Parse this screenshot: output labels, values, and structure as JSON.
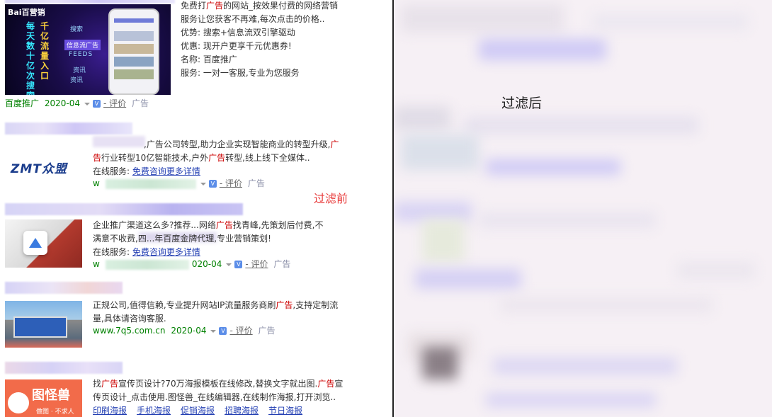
{
  "labels": {
    "before": "过滤前",
    "after": "过滤后"
  },
  "ads": [
    {
      "id": "baidu",
      "image_text": {
        "brand": "Bai百营销",
        "side": "每天数十亿次搜索",
        "side2": "千亿流量入口",
        "menu": [
          "搜索",
          "信息流广告",
          "FEEDS",
          "资讯",
          "资讯"
        ]
      },
      "lines": [
        {
          "pre": "免费打",
          "red": "广告",
          "post": "的网站_按效果付费的网络营销"
        },
        {
          "text": "服务让您获客不再难,每次点击的价格.."
        },
        {
          "text": "优势:  搜索+信息流双引擎驱动"
        },
        {
          "text": "优惠:  现开户更享千元优惠券!"
        },
        {
          "text": "名称:  百度推广"
        },
        {
          "text": "服务:  一对一客服,专业为您服务"
        }
      ],
      "meta": {
        "source": "百度推广",
        "date": "2020-04",
        "review": "- 评价",
        "ad": "广告"
      }
    },
    {
      "id": "zmt",
      "logo": "ZMT众盟",
      "lines": [
        {
          "pre": ",广告公司转型,助力企业实现智能商业的转型升级,",
          "red": "广",
          "post": ""
        },
        {
          "red": "告",
          "post": "行业转型10亿智能技术,户外",
          "red2": "广告",
          "post2": "转型,线上线下全媒体.."
        }
      ],
      "service_label": "在线服务:",
      "service_link": "免费咨询更多详情",
      "meta": {
        "prefix": "w",
        "review": "- 评价",
        "ad": "广告"
      }
    },
    {
      "id": "qingfeng",
      "lines": [
        {
          "pre": "企业推广渠道这么多?推荐...网络",
          "red": "广告",
          "post": "找青峰,先策划后付费,不"
        },
        {
          "text": "满意不收费,四...年百度金牌代理,专业营销策划!"
        }
      ],
      "service_label": "在线服务:",
      "service_link": "免费咨询更多详情",
      "meta": {
        "prefix": "w",
        "date": "020-04",
        "review": "- 评价",
        "ad": "广告"
      }
    },
    {
      "id": "7q5",
      "lines": [
        {
          "pre": "正规公司,值得信赖,专业提升网站IP流量服务商刷",
          "red": "广告",
          "post": ",支持定制流"
        },
        {
          "text": "量,具体请咨询客服."
        }
      ],
      "meta": {
        "url": "www.7q5.com.cn",
        "date": "2020-04",
        "review": "- 评价",
        "ad": "广告"
      }
    },
    {
      "id": "tuguaishou",
      "logo": "图怪兽",
      "logo_sub": "做图 · 不求人",
      "lines": [
        {
          "pre": "找",
          "red": "广告",
          "post": "宣传页设计?70万海报模板在线修改,替换文字就出图.",
          "red2": "广告",
          "post2": "宣"
        },
        {
          "text": "传页设计_点击使用.图怪兽_在线编辑器,在线制作海报,打开浏览.."
        }
      ],
      "links": [
        "印刷海报",
        "手机海报",
        "促销海报",
        "招聘海报",
        "节日海报"
      ]
    }
  ]
}
